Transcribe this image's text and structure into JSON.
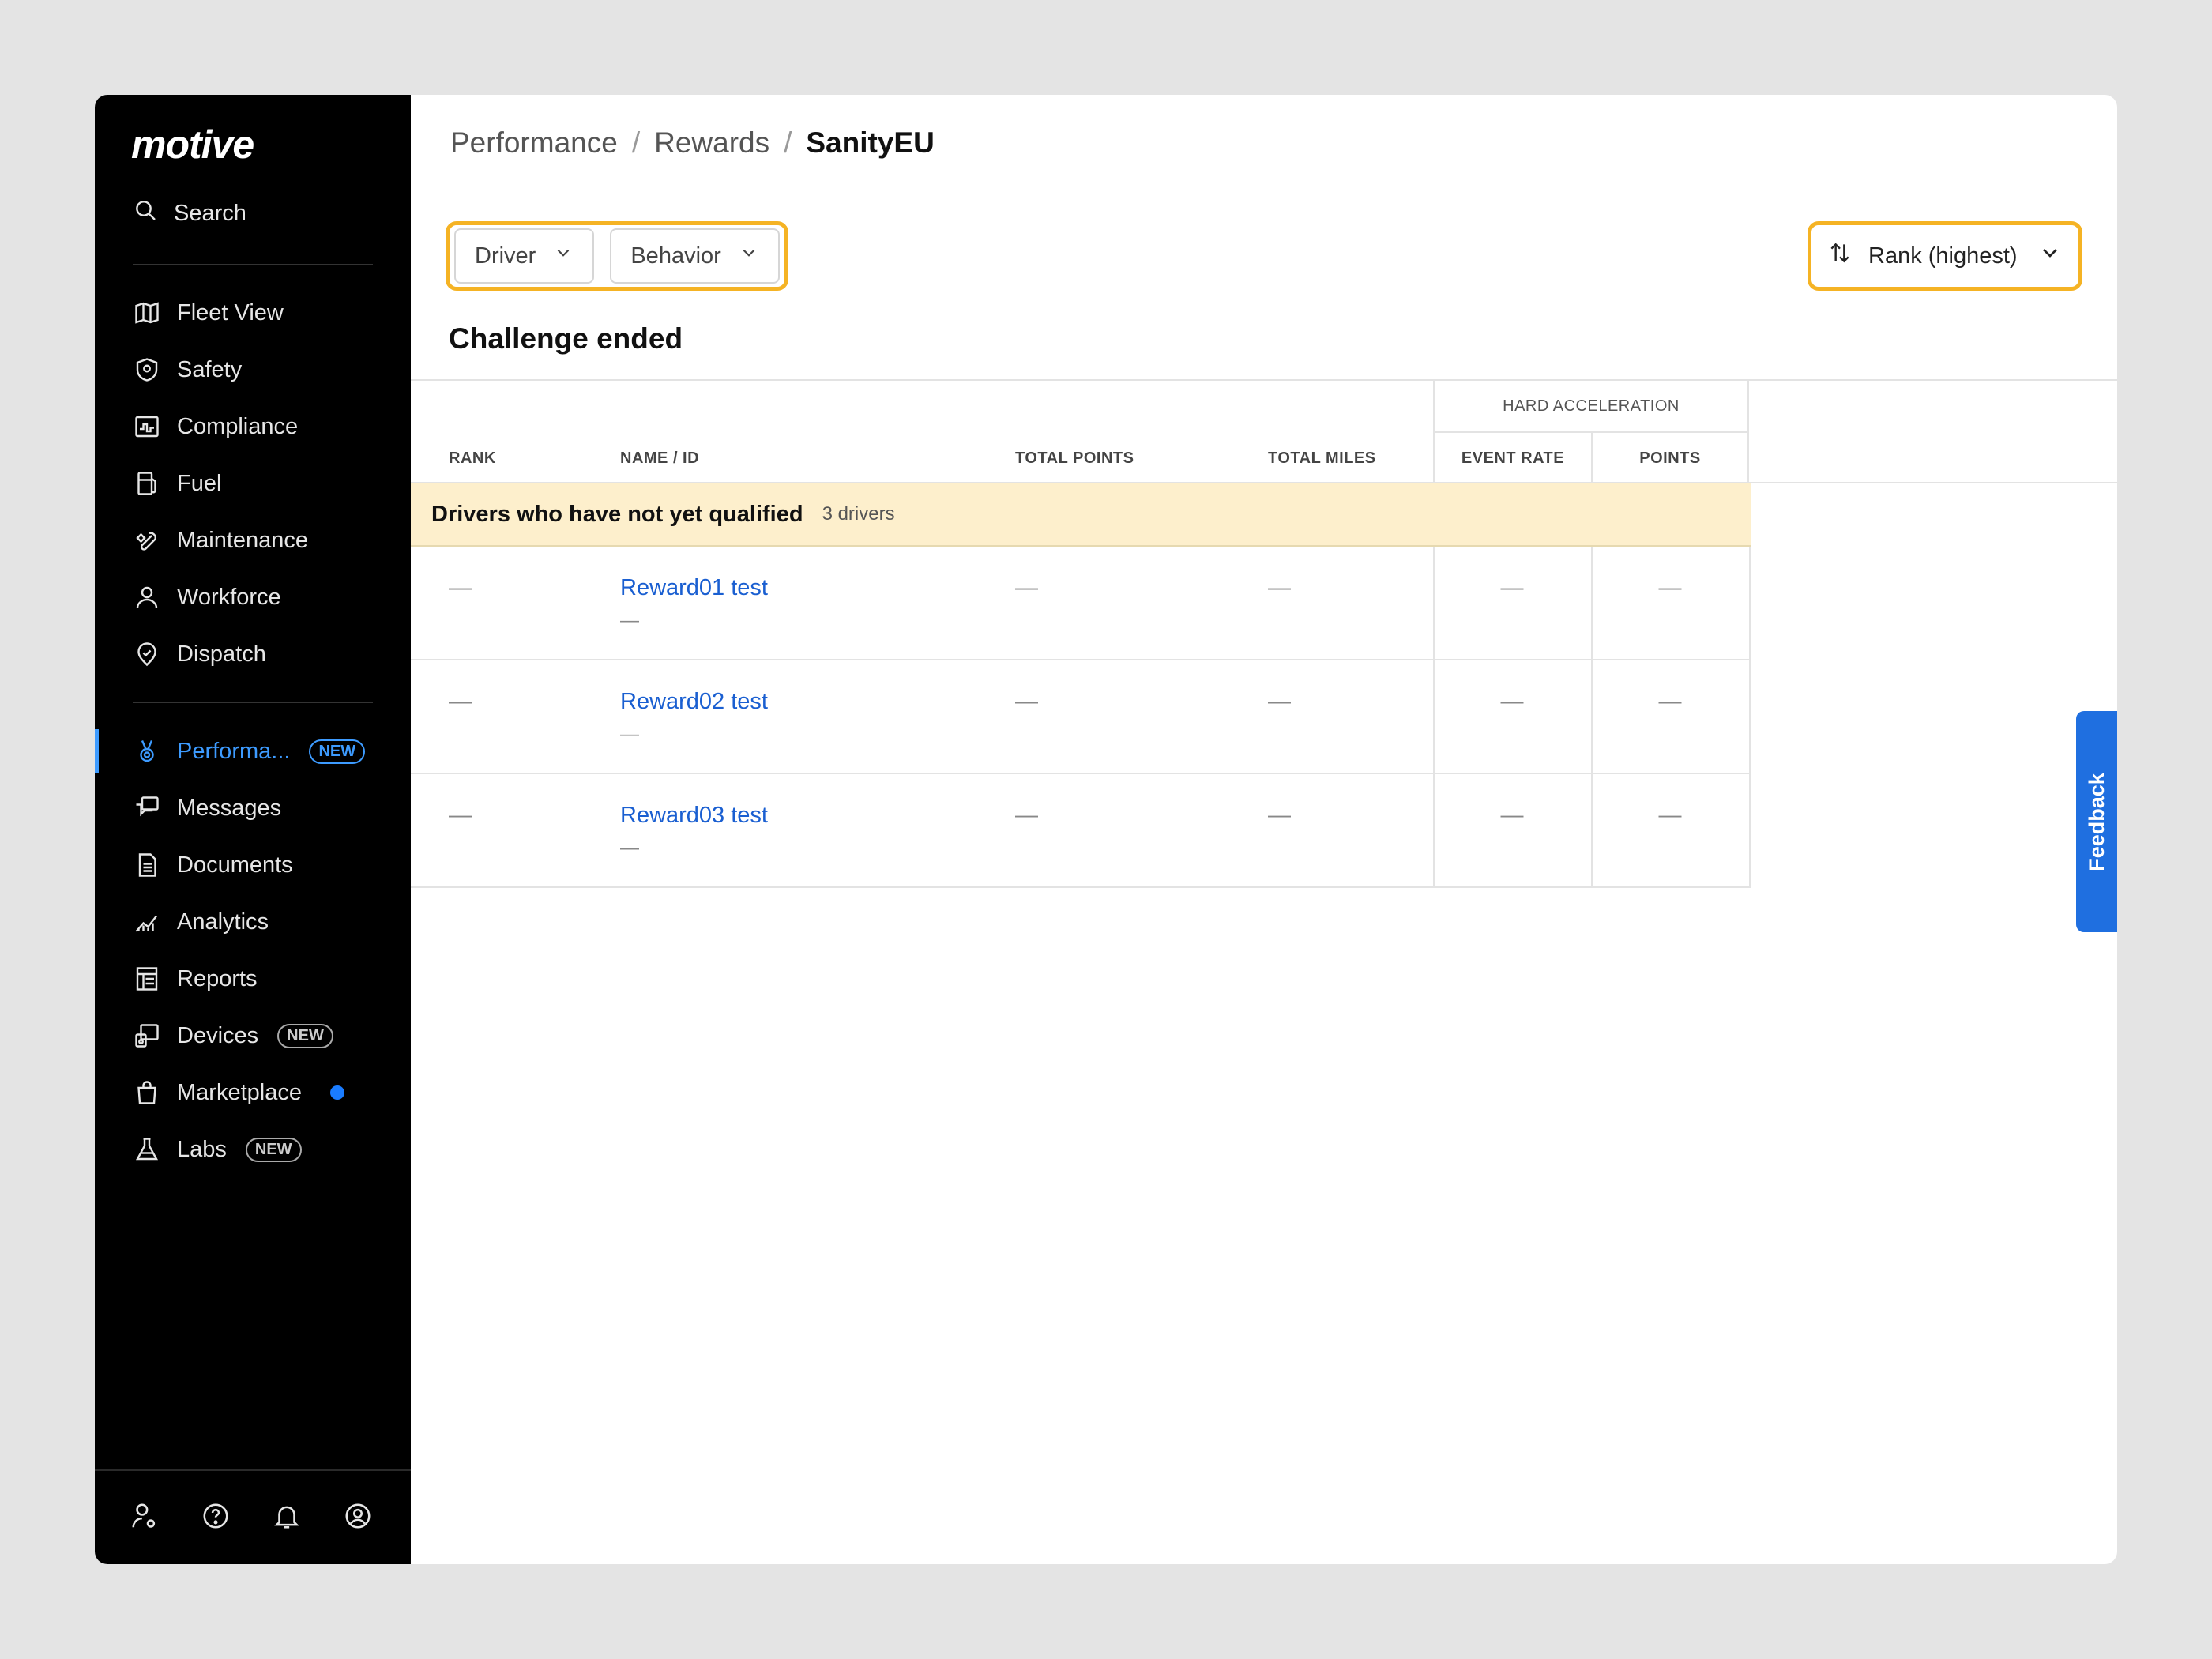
{
  "sidebar": {
    "logo": "motive",
    "search_label": "Search",
    "group1": [
      {
        "label": "Fleet View",
        "icon": "map-icon"
      },
      {
        "label": "Safety",
        "icon": "shield-icon"
      },
      {
        "label": "Compliance",
        "icon": "compliance-icon"
      },
      {
        "label": "Fuel",
        "icon": "fuel-icon"
      },
      {
        "label": "Maintenance",
        "icon": "wrench-icon"
      },
      {
        "label": "Workforce",
        "icon": "person-icon"
      },
      {
        "label": "Dispatch",
        "icon": "dispatch-icon"
      }
    ],
    "group2": [
      {
        "label": "Performa...",
        "icon": "medal-icon",
        "badge": "NEW",
        "active": true
      },
      {
        "label": "Messages",
        "icon": "messages-icon"
      },
      {
        "label": "Documents",
        "icon": "document-icon"
      },
      {
        "label": "Analytics",
        "icon": "analytics-icon"
      },
      {
        "label": "Reports",
        "icon": "reports-icon"
      },
      {
        "label": "Devices",
        "icon": "devices-icon",
        "badge": "NEW"
      },
      {
        "label": "Marketplace",
        "icon": "bag-icon",
        "dot": true
      },
      {
        "label": "Labs",
        "icon": "flask-icon",
        "badge": "NEW"
      }
    ],
    "footer_icons": [
      "user-settings-icon",
      "help-icon",
      "bell-icon",
      "account-icon"
    ]
  },
  "breadcrumb": {
    "items": [
      "Performance",
      "Rewards"
    ],
    "current": "SanityEU",
    "separator": "/"
  },
  "filters": {
    "driver": "Driver",
    "behavior": "Behavior"
  },
  "sort": {
    "label": "Rank (highest)"
  },
  "section_title": "Challenge ended",
  "table": {
    "group_header": "HARD ACCELERATION",
    "columns": {
      "rank": "RANK",
      "name": "NAME / ID",
      "total_points": "TOTAL POINTS",
      "total_miles": "TOTAL MILES",
      "event_rate": "EVENT RATE",
      "points": "POINTS"
    },
    "group": {
      "title": "Drivers who have not yet qualified",
      "count": "3 drivers"
    },
    "rows": [
      {
        "rank": "—",
        "name": "Reward01 test",
        "id": "—",
        "total_points": "—",
        "total_miles": "—",
        "event_rate": "—",
        "points": "—"
      },
      {
        "rank": "—",
        "name": "Reward02 test",
        "id": "—",
        "total_points": "—",
        "total_miles": "—",
        "event_rate": "—",
        "points": "—"
      },
      {
        "rank": "—",
        "name": "Reward03 test",
        "id": "—",
        "total_points": "—",
        "total_miles": "—",
        "event_rate": "—",
        "points": "—"
      }
    ]
  },
  "feedback_label": "Feedback",
  "colors": {
    "accent": "#3d9bff",
    "highlight": "#f5b324",
    "link": "#1a5fd1",
    "banner": "#fdefcc"
  }
}
